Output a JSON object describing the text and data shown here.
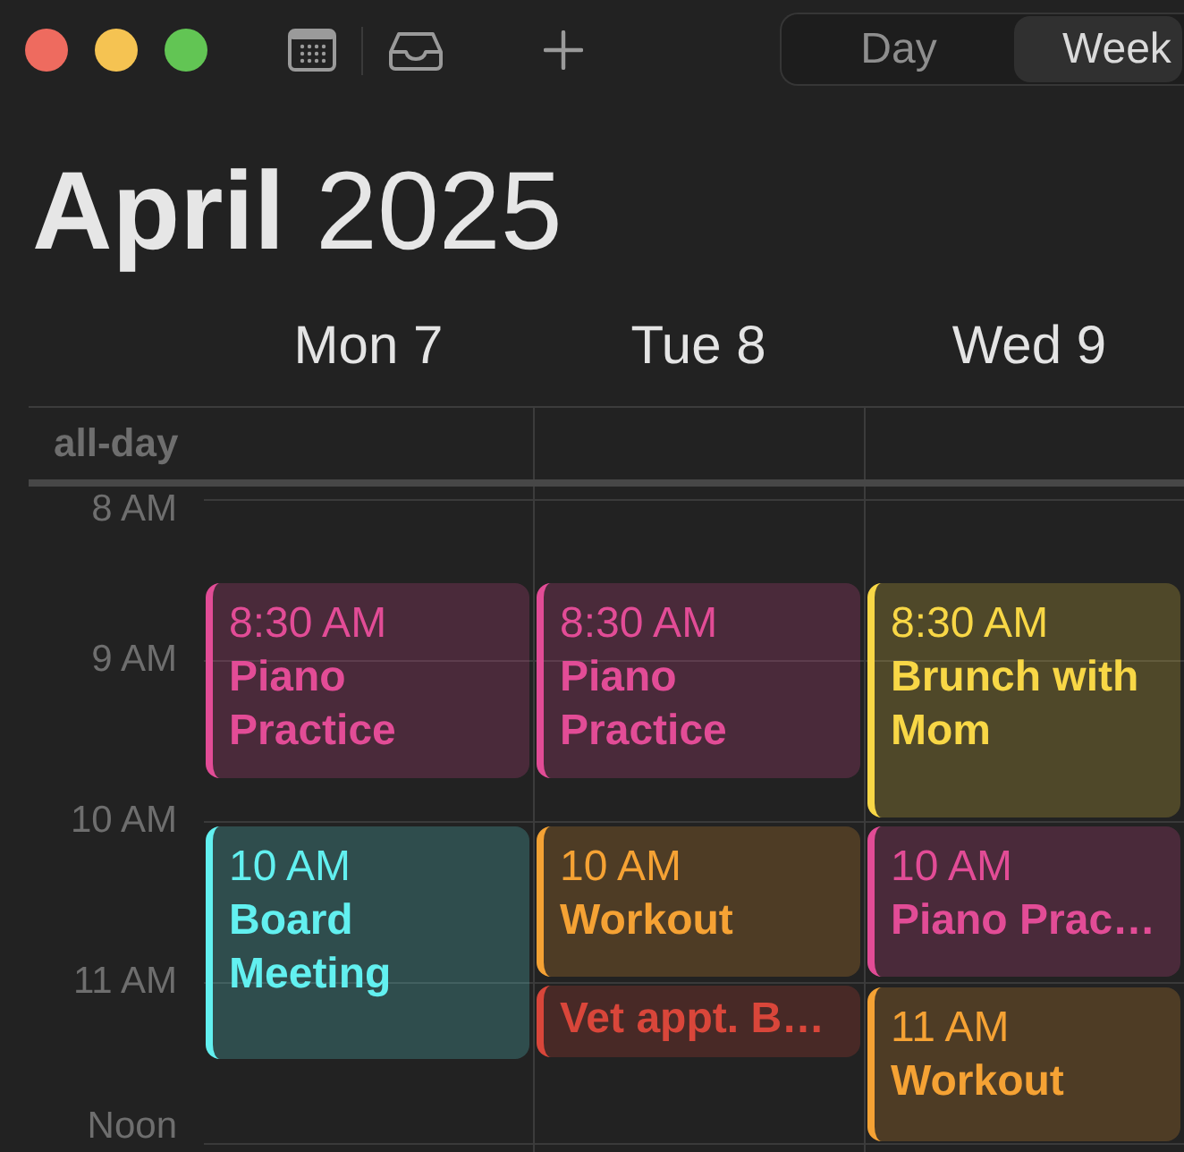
{
  "toolbar": {
    "view_tabs": [
      {
        "label": "Day",
        "selected": false
      },
      {
        "label": "Week",
        "selected": true
      }
    ]
  },
  "title": "**April** 2025",
  "all_day_label": "all-day",
  "hour_labels": [
    "8 AM",
    "9 AM",
    "10 AM",
    "11 AM",
    "Noon"
  ],
  "days": [
    {
      "label": "Mon 7",
      "events": [
        {
          "time": "8:30 AM",
          "title": "Piano Practice",
          "color": "#e24c96"
        },
        {
          "time": "10 AM",
          "title": "Board Meeting",
          "color": "#62f0f0"
        }
      ]
    },
    {
      "label": "Tue 8",
      "events": [
        {
          "time": "8:30 AM",
          "title": "Piano Practice",
          "color": "#e24c96"
        },
        {
          "time": "10 AM",
          "title": "Workout",
          "color": "#f5a234"
        },
        {
          "title": "Vet appt. B…",
          "color": "#d9463a"
        }
      ]
    },
    {
      "label": "Wed 9",
      "events": [
        {
          "time": "8:30 AM",
          "title": "Brunch with Mom",
          "color": "#f8d746"
        },
        {
          "time": "10 AM",
          "title": "Piano Prac…",
          "color": "#e24c96"
        },
        {
          "time": "11 AM",
          "title": "Workout",
          "color": "#f5a234"
        }
      ]
    }
  ]
}
